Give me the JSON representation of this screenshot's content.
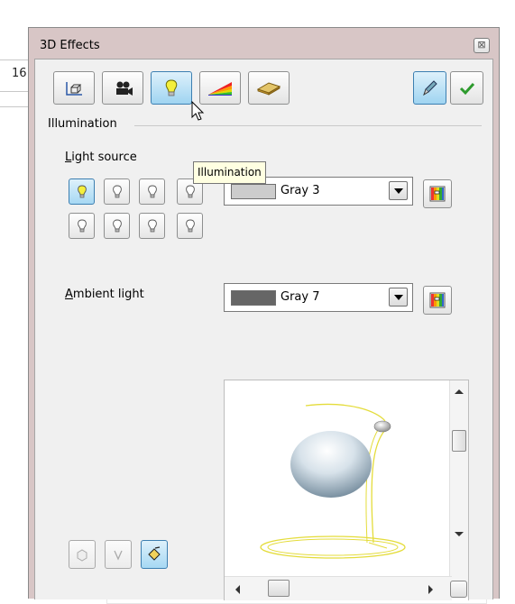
{
  "background": {
    "ruler_text": "16"
  },
  "dialog": {
    "title": "3D Effects",
    "close_glyph": "⊠"
  },
  "toolbar": {
    "buttons": [
      {
        "name": "geometry",
        "icon": "geometry-icon",
        "active": false
      },
      {
        "name": "shading",
        "icon": "camera-icon",
        "active": false
      },
      {
        "name": "illumination",
        "icon": "lightbulb-icon",
        "active": true
      },
      {
        "name": "textures",
        "icon": "rainbow-texture-icon",
        "active": false
      },
      {
        "name": "material",
        "icon": "material-slab-icon",
        "active": false
      }
    ],
    "convert_3d": {
      "icon": "eyedropper-icon",
      "active": true
    },
    "assign": {
      "icon": "checkmark-icon"
    }
  },
  "section": {
    "title": "Illumination"
  },
  "light_source": {
    "label_underlined": "L",
    "label_rest": "ight source",
    "buttons_on": [
      true,
      false,
      false,
      false,
      false,
      false,
      false,
      false
    ],
    "color": {
      "name": "Gray 3",
      "swatch": "#cccccc"
    }
  },
  "ambient_light": {
    "label_underlined": "A",
    "label_rest": "mbient light",
    "color": {
      "name": "Gray 7",
      "swatch": "#666666"
    }
  },
  "tooltip": {
    "text": "Illumination"
  },
  "colors": {
    "accent_border": "#3c7fb1",
    "lamp_yellow": "#e4dc3a",
    "window_frame": "#d8c6c6"
  }
}
